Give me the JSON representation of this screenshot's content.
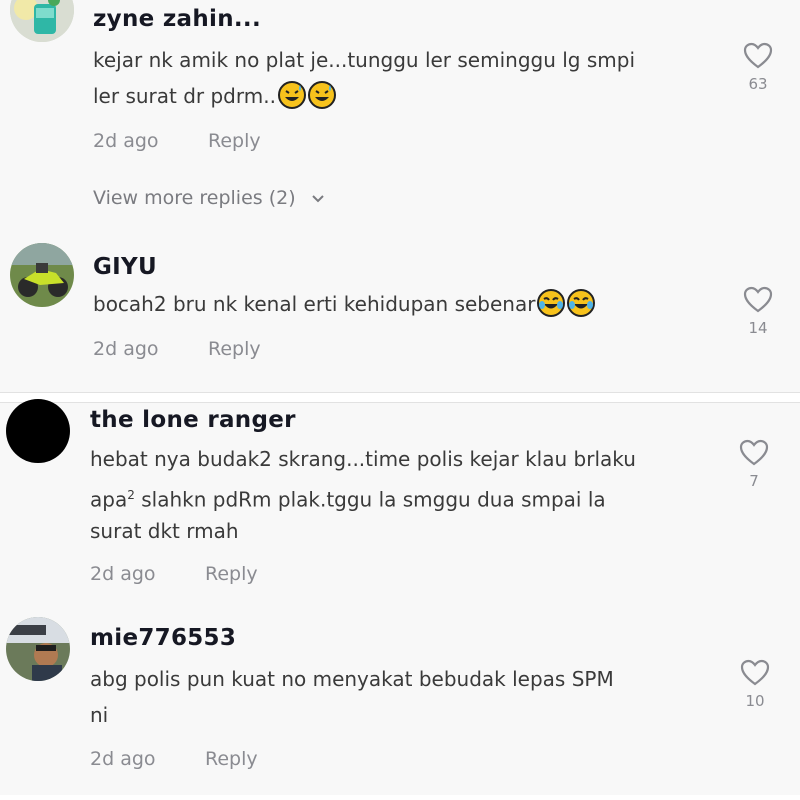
{
  "colors": {
    "username": "#161823",
    "text": "#3a3a3a",
    "meta": "#8a8b91",
    "background": "#f8f8f8"
  },
  "comments": [
    {
      "username": "zyne zahin...",
      "lines": [
        "kejar nk amik no plat je...tunggu ler seminggu lg smpi",
        "ler surat dr pdrm.."
      ],
      "emojis": [
        "sweat-smile-emoji",
        "sweat-smile-emoji"
      ],
      "time": "2d ago",
      "reply": "Reply",
      "likes": "63",
      "view_more": "View more replies (2)"
    },
    {
      "username": "GIYU",
      "lines": [
        "bocah2 bru nk kenal erti kehidupan sebenar"
      ],
      "emojis": [
        "joy-emoji",
        "joy-emoji"
      ],
      "time": "2d ago",
      "reply": "Reply",
      "likes": "14"
    },
    {
      "username": "the lone ranger",
      "lines": [
        "hebat nya budak2 skrang...time polis kejar klau brlaku",
        "apa",
        "slahkn pdRm plak.tggu la smggu dua smpai la",
        "surat dkt rmah"
      ],
      "superscript": "2",
      "time": "2d ago",
      "reply": "Reply",
      "likes": "7"
    },
    {
      "username": "mie776553",
      "lines": [
        "abg polis pun kuat no menyakat bebudak lepas SPM",
        "ni"
      ],
      "time": "2d ago",
      "reply": "Reply",
      "likes": "10"
    }
  ]
}
